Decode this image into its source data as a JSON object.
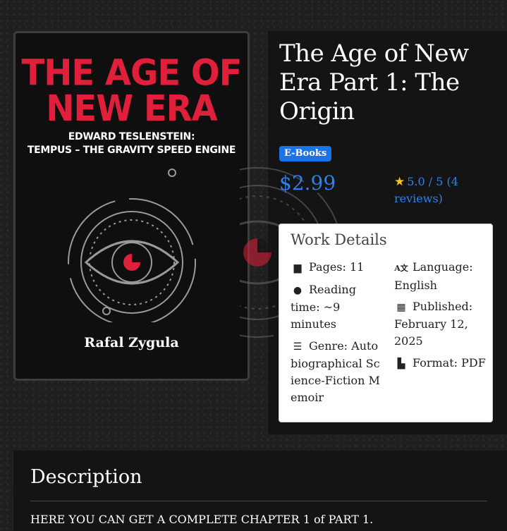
{
  "cover": {
    "title_line1": "THE AGE OF",
    "title_line2": "NEW ERA",
    "subtitle_line1": "EDWARD TESLENSTEIN:",
    "subtitle_line2": "TEMPUS – THE GRAVITY SPEED ENGINE",
    "author": "Rafal Zygula",
    "accent_color": "#e01f3a"
  },
  "product": {
    "title": "The Age of New Era Part 1: The Origin",
    "category_badge": "E-Books",
    "price": "$2.99",
    "rating_text": "5.0 / 5 (4 reviews)",
    "rating_icon": "star-icon",
    "accent_color": "#2f80ed"
  },
  "details": {
    "heading": "Work Details",
    "pages": "Pages: 11",
    "reading_time": "Reading time: ~9 minutes",
    "genre": "Genre: Autobiographical Science-Fiction Memoir",
    "language": "Language: English",
    "published": "Published: February 12, 2025",
    "format": "Format: PDF"
  },
  "description": {
    "heading": "Description",
    "text": "HERE YOU CAN GET A COMPLETE CHAPTER 1 of PART 1."
  }
}
